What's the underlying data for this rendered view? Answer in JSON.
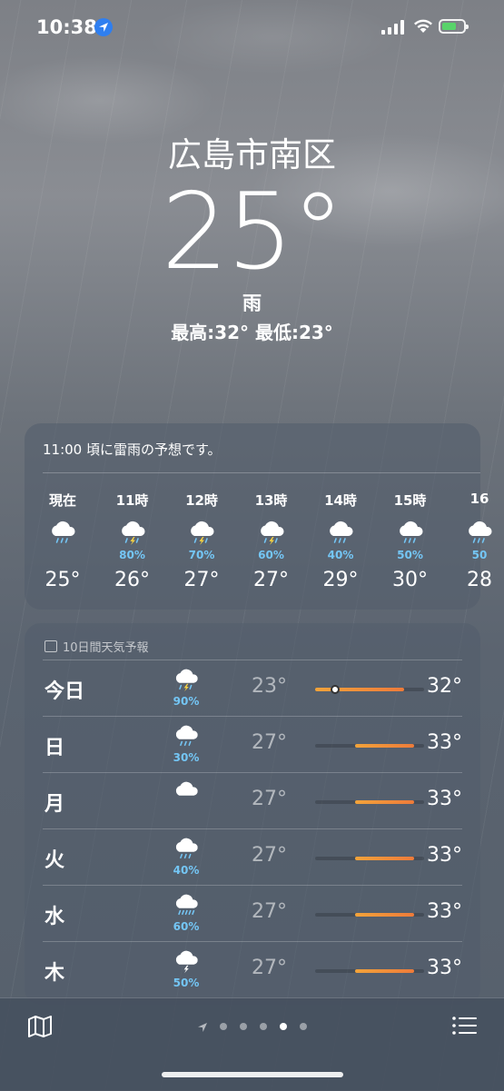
{
  "status_bar": {
    "time": "10:38"
  },
  "header": {
    "city": "広島市南区",
    "temperature": "25°",
    "condition": "雨",
    "hilo": "最高:32°  最低:23°"
  },
  "hourly": {
    "summary": "11:00 頃に雷雨の予想です。",
    "items": [
      {
        "label": "現在",
        "icon": "rain-cloud-icon",
        "pct": "",
        "temp": "25°"
      },
      {
        "label": "11時",
        "icon": "thunderstorm-icon",
        "pct": "80%",
        "temp": "26°"
      },
      {
        "label": "12時",
        "icon": "thunderstorm-icon",
        "pct": "70%",
        "temp": "27°"
      },
      {
        "label": "13時",
        "icon": "thunderstorm-icon",
        "pct": "60%",
        "temp": "27°"
      },
      {
        "label": "14時",
        "icon": "rain-cloud-icon",
        "pct": "40%",
        "temp": "29°"
      },
      {
        "label": "15時",
        "icon": "rain-cloud-icon",
        "pct": "50%",
        "temp": "30°"
      },
      {
        "label": "16",
        "icon": "rain-cloud-icon",
        "pct": "50",
        "temp": "28"
      }
    ]
  },
  "daily": {
    "header": "10日間天気予報",
    "scale": {
      "min": 23,
      "max": 34
    },
    "current_temp": 25,
    "rows": [
      {
        "day": "今日",
        "icon": "thunderstorm-icon",
        "pct": "90%",
        "lo": "23°",
        "hi": "32°",
        "lo_val": 23,
        "hi_val": 32,
        "today": true
      },
      {
        "day": "日",
        "icon": "rain-cloud-icon",
        "pct": "30%",
        "lo": "27°",
        "hi": "33°",
        "lo_val": 27,
        "hi_val": 33
      },
      {
        "day": "月",
        "icon": "cloud-icon",
        "pct": "",
        "lo": "27°",
        "hi": "33°",
        "lo_val": 27,
        "hi_val": 33
      },
      {
        "day": "火",
        "icon": "rain-cloud-icon",
        "pct": "40%",
        "lo": "27°",
        "hi": "33°",
        "lo_val": 27,
        "hi_val": 33
      },
      {
        "day": "水",
        "icon": "heavy-rain-cloud-icon",
        "pct": "60%",
        "lo": "27°",
        "hi": "33°",
        "lo_val": 27,
        "hi_val": 33
      },
      {
        "day": "木",
        "icon": "lightning-cloud-icon",
        "pct": "50%",
        "lo": "27°",
        "hi": "33°",
        "lo_val": 27,
        "hi_val": 33
      }
    ]
  },
  "bottom_bar": {
    "map_icon": "map-icon",
    "list_icon": "list-icon",
    "page_count": 5,
    "active_page": 3
  },
  "colors": {
    "precip": "#74c6f5",
    "bar_start": "#f2a33a",
    "bar_end": "#ee7b3a",
    "location_blue": "#2f7ff0"
  }
}
